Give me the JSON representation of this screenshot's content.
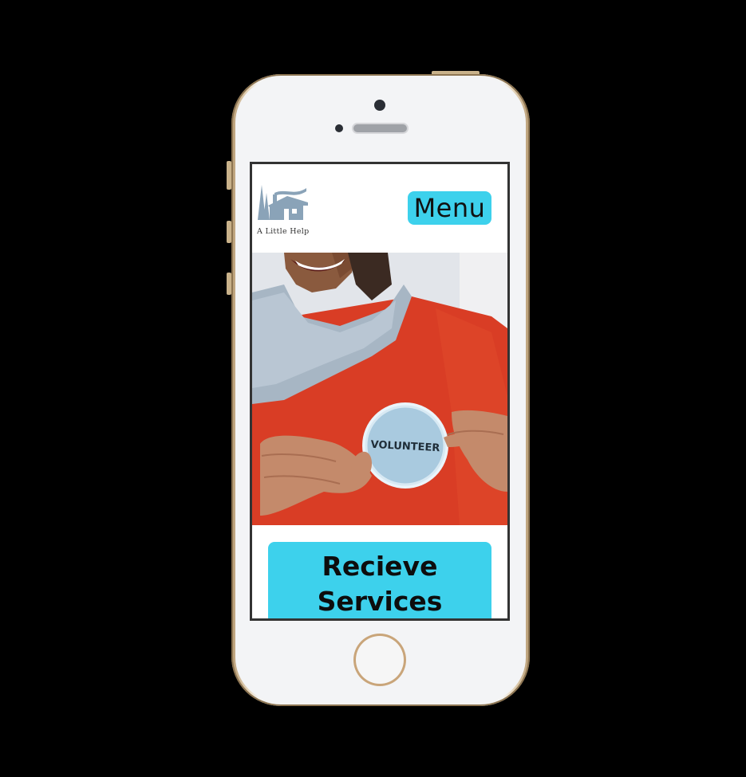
{
  "header": {
    "logo_text": "A Little Help",
    "menu_label": "Menu"
  },
  "hero": {
    "badge_text": "VOLUNTEER"
  },
  "main": {
    "services_line1": "Recieve",
    "services_line2": "Services"
  },
  "colors": {
    "accent": "#3dd1ec",
    "shirt": "#d93d25",
    "logo": "#8aa3b8"
  }
}
